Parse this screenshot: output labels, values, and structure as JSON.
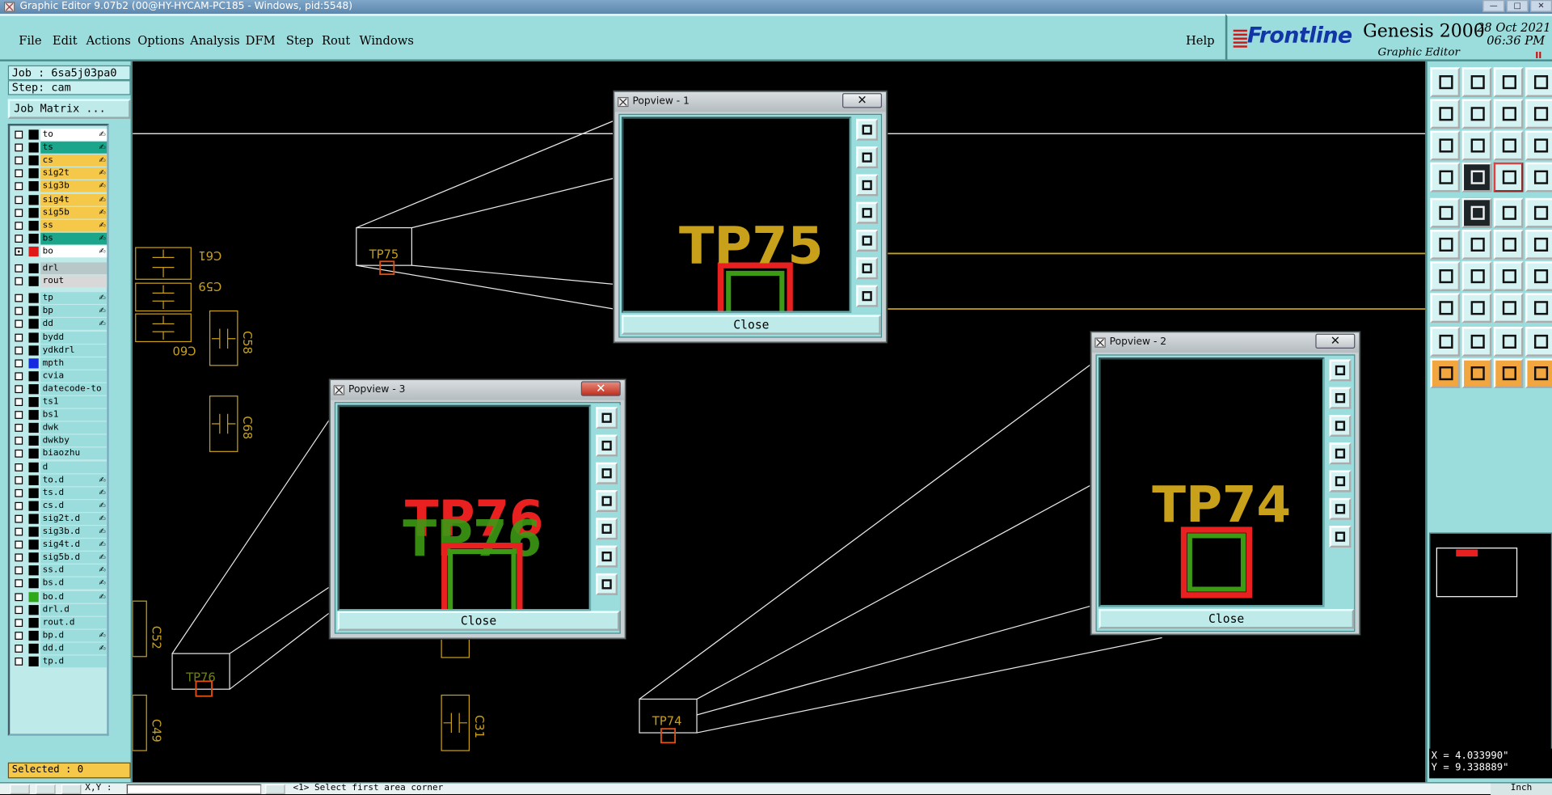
{
  "window": {
    "title": "Graphic Editor 9.07b2 (00@HY-HYCAM-PC185 - Windows, pid:5548)",
    "controls": [
      "—",
      "□",
      "✕"
    ]
  },
  "menu": {
    "items": [
      "File",
      "Edit",
      "Actions",
      "Options",
      "Analysis",
      "DFM",
      "Step",
      "Rout",
      "Windows"
    ],
    "help": "Help"
  },
  "brand": {
    "logo": "Frontline",
    "product": "Genesis 2000",
    "subtitle": "Graphic Editor",
    "date": "28 Oct 2021",
    "time": "06:36 PM",
    "indicator": "II"
  },
  "job": {
    "job_line": "Job : 6sa5j03pa0",
    "step_line": "Step: cam",
    "matrix_button": "Job Matrix ..."
  },
  "layers": [
    {
      "name": "to",
      "color": "#ffffff",
      "swatch": "#000000",
      "checked": false,
      "write": true
    },
    {
      "name": "ts",
      "color": "#1ba58a",
      "swatch": "#000000",
      "checked": false,
      "write": true
    },
    {
      "name": "cs",
      "color": "#f6c84a",
      "swatch": "#000000",
      "checked": false,
      "write": true
    },
    {
      "name": "sig2t",
      "color": "#f6c84a",
      "swatch": "#000000",
      "checked": false,
      "write": true
    },
    {
      "name": "sig3b",
      "color": "#f6c84a",
      "swatch": "#000000",
      "checked": false,
      "write": true
    },
    {
      "name": "sig4t",
      "color": "#f6c84a",
      "swatch": "#000000",
      "checked": false,
      "write": true
    },
    {
      "name": "sig5b",
      "color": "#f6c84a",
      "swatch": "#000000",
      "checked": false,
      "write": true
    },
    {
      "name": "ss",
      "color": "#f6c84a",
      "swatch": "#000000",
      "checked": false,
      "write": true
    },
    {
      "name": "bs",
      "color": "#1ba58a",
      "swatch": "#000000",
      "checked": false,
      "write": true
    },
    {
      "name": "bo",
      "color": "#ffffff",
      "swatch": "#e01818",
      "checked": true,
      "write": true
    },
    {
      "name": "drl",
      "color": "#b8c8c8",
      "swatch": "#000000",
      "checked": false,
      "write": false
    },
    {
      "name": "rout",
      "color": "#d8d8d8",
      "swatch": "#000000",
      "checked": false,
      "write": false
    },
    {
      "name": "tp",
      "color": "#9bdcdc",
      "swatch": "#000000",
      "checked": false,
      "write": true
    },
    {
      "name": "bp",
      "color": "#9bdcdc",
      "swatch": "#000000",
      "checked": false,
      "write": true
    },
    {
      "name": "dd",
      "color": "#9bdcdc",
      "swatch": "#000000",
      "checked": false,
      "write": true
    },
    {
      "name": "bydd",
      "color": "#9bdcdc",
      "swatch": "#000000",
      "checked": false,
      "write": false
    },
    {
      "name": "ydkdrl",
      "color": "#9bdcdc",
      "swatch": "#000000",
      "checked": false,
      "write": false
    },
    {
      "name": "mpth",
      "color": "#9bdcdc",
      "swatch": "#1428e0",
      "checked": false,
      "write": false
    },
    {
      "name": "cvia",
      "color": "#9bdcdc",
      "swatch": "#000000",
      "checked": false,
      "write": false
    },
    {
      "name": "datecode-to",
      "color": "#9bdcdc",
      "swatch": "#000000",
      "checked": false,
      "write": false
    },
    {
      "name": "ts1",
      "color": "#9bdcdc",
      "swatch": "#000000",
      "checked": false,
      "write": false
    },
    {
      "name": "bs1",
      "color": "#9bdcdc",
      "swatch": "#000000",
      "checked": false,
      "write": false
    },
    {
      "name": "dwk",
      "color": "#9bdcdc",
      "swatch": "#000000",
      "checked": false,
      "write": false
    },
    {
      "name": "dwkby",
      "color": "#9bdcdc",
      "swatch": "#000000",
      "checked": false,
      "write": false
    },
    {
      "name": "biaozhu",
      "color": "#9bdcdc",
      "swatch": "#000000",
      "checked": false,
      "write": false
    },
    {
      "name": "d",
      "color": "#9bdcdc",
      "swatch": "#000000",
      "checked": false,
      "write": false
    },
    {
      "name": "to.d",
      "color": "#9bdcdc",
      "swatch": "#000000",
      "checked": false,
      "write": true
    },
    {
      "name": "ts.d",
      "color": "#9bdcdc",
      "swatch": "#000000",
      "checked": false,
      "write": true
    },
    {
      "name": "cs.d",
      "color": "#9bdcdc",
      "swatch": "#000000",
      "checked": false,
      "write": true
    },
    {
      "name": "sig2t.d",
      "color": "#9bdcdc",
      "swatch": "#000000",
      "checked": false,
      "write": true
    },
    {
      "name": "sig3b.d",
      "color": "#9bdcdc",
      "swatch": "#000000",
      "checked": false,
      "write": true
    },
    {
      "name": "sig4t.d",
      "color": "#9bdcdc",
      "swatch": "#000000",
      "checked": false,
      "write": true
    },
    {
      "name": "sig5b.d",
      "color": "#9bdcdc",
      "swatch": "#000000",
      "checked": false,
      "write": true
    },
    {
      "name": "ss.d",
      "color": "#9bdcdc",
      "swatch": "#000000",
      "checked": false,
      "write": true
    },
    {
      "name": "bs.d",
      "color": "#9bdcdc",
      "swatch": "#000000",
      "checked": false,
      "write": true
    },
    {
      "name": "bo.d",
      "color": "#9bdcdc",
      "swatch": "#2ea818",
      "checked": false,
      "write": true
    },
    {
      "name": "drl.d",
      "color": "#9bdcdc",
      "swatch": "#000000",
      "checked": false,
      "write": false
    },
    {
      "name": "rout.d",
      "color": "#9bdcdc",
      "swatch": "#000000",
      "checked": false,
      "write": false
    },
    {
      "name": "bp.d",
      "color": "#9bdcdc",
      "swatch": "#000000",
      "checked": false,
      "write": true
    },
    {
      "name": "dd.d",
      "color": "#9bdcdc",
      "swatch": "#000000",
      "checked": false,
      "write": true
    },
    {
      "name": "tp.d",
      "color": "#9bdcdc",
      "swatch": "#000000",
      "checked": false,
      "write": false
    }
  ],
  "write_marker": "✍",
  "status": {
    "selected": "Selected : 0"
  },
  "canvas": {
    "components": [
      "C61",
      "C59",
      "C60",
      "C58",
      "C68",
      "C52",
      "C49",
      "C31"
    ],
    "testpoints": [
      "TP75",
      "TP76",
      "TP74"
    ]
  },
  "popviews": [
    {
      "title": "Popview - 1",
      "label": "TP75",
      "close": "Close"
    },
    {
      "title": "Popview - 2",
      "label": "TP74",
      "close": "Close"
    },
    {
      "title": "Popview - 3",
      "label": "TP76",
      "close": "Close"
    }
  ],
  "coords": {
    "x": "X = 4.033990\"",
    "y": "Y = 9.338889\""
  },
  "bottom": {
    "xy_label": "X,Y :",
    "prompt": "<1>  Select first area corner",
    "units": "Inch"
  },
  "colors": {
    "panel": "#9bdcdc",
    "gold": "#c8a01a",
    "red": "#e82020",
    "green": "#3c9a14"
  }
}
